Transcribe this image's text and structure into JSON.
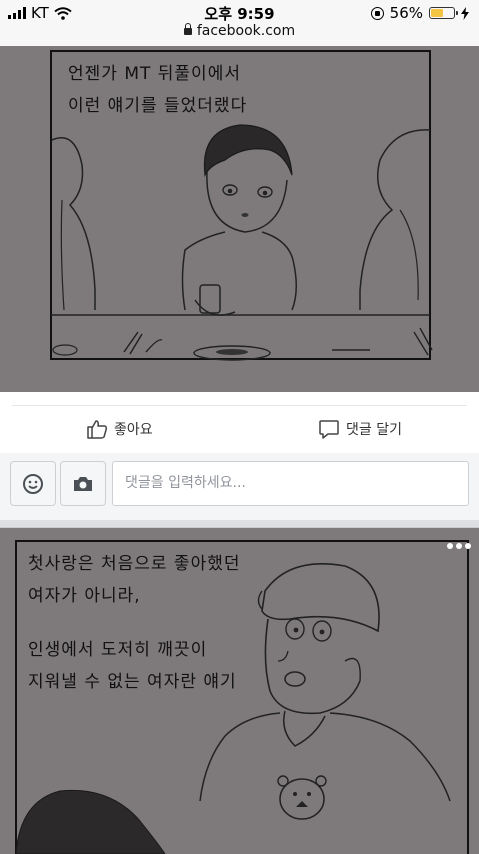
{
  "status_bar": {
    "carrier": "KT",
    "time": "오후 9:59",
    "url": "facebook.com",
    "battery": "56%",
    "battery_level": 0.56
  },
  "post1": {
    "caption_line1": "언젠가 MT 뒤풀이에서",
    "caption_line2": "이런 얘기를 들었더랬다"
  },
  "actions": {
    "like_label": "좋아요",
    "comment_label": "댓글 달기"
  },
  "composer": {
    "placeholder": "댓글을 입력하세요..."
  },
  "post2": {
    "caption_line1": "첫사랑은 처음으로 좋아했던",
    "caption_line2": "여자가 아니라,",
    "caption_line3": "인생에서 도저히 깨끗이",
    "caption_line4": "지워낼 수 없는 여자란 얘기"
  },
  "colors": {
    "panel_bg": "#7e7a7c",
    "battery_fill": "#f4c542"
  }
}
